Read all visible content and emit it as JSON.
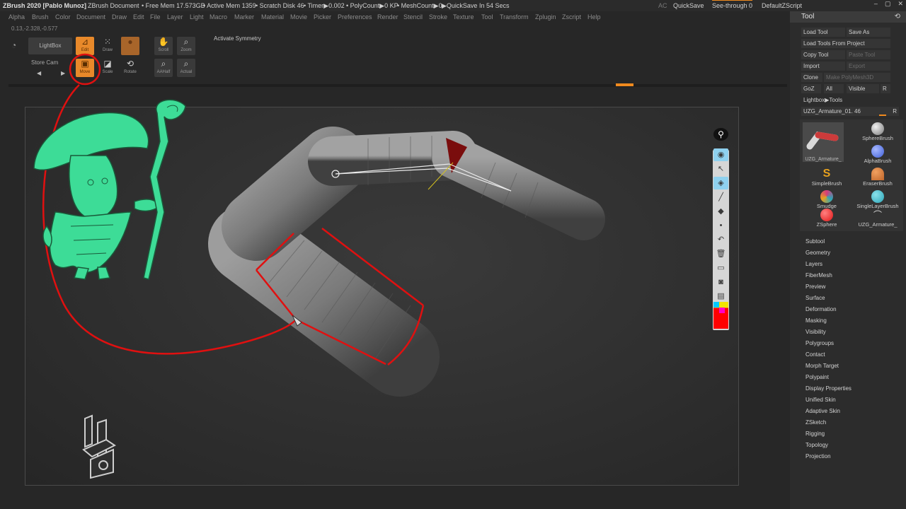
{
  "titlebar": {
    "app": "ZBrush 2020 [Pablo Munoz]",
    "document": "ZBrush Document",
    "free_mem": "• Free Mem 17.573GB",
    "active_mem": "• Active Mem 1359",
    "scratch": "• Scratch Disk 46",
    "timer": "• Timer▶0.002",
    "polycount": "• PolyCount▶0 KP",
    "meshcount": "• MeshCount▶0",
    "quicksave_in": "▶QuickSave In 54 Secs",
    "ac": "AC",
    "quicksave": "QuickSave",
    "see_through": "See-through  0",
    "default_script": "DefaultZScript"
  },
  "menu": [
    "Alpha",
    "Brush",
    "Color",
    "Document",
    "Draw",
    "Edit",
    "File",
    "Layer",
    "Light",
    "Macro",
    "Marker",
    "Material",
    "Movie",
    "Picker",
    "Preferences",
    "Render",
    "Stencil",
    "Stroke",
    "Texture",
    "Tool",
    "Transform",
    "Zplugin",
    "Zscript",
    "Help"
  ],
  "coords": "0.13,-2.328,-0.577",
  "shelf": {
    "lightbox": "LightBox",
    "store_cam": "Store Cam",
    "activate_symmetry": "Activate Symmetry",
    "edit": "Edit",
    "draw": "Draw",
    "move": "Move",
    "scale": "Scale",
    "rotate": "Rotate",
    "scroll": "Scroll",
    "zoom": "Zoom",
    "actual": "Actual",
    "aahalf": "AAHalf"
  },
  "tool_panel": {
    "title": "Tool",
    "load_tool": "Load Tool",
    "save_as": "Save As",
    "load_from_project": "Load Tools From Project",
    "copy_tool": "Copy Tool",
    "paste_tool": "Paste Tool",
    "import": "Import",
    "export": "Export",
    "clone": "Clone",
    "make_polymesh": "Make PolyMesh3D",
    "goz": "GoZ",
    "all": "All",
    "visible": "Visible",
    "r": "R",
    "lightbox_tools": "Lightbox▶Tools",
    "current_tool": "UZG_Armature_01. 46",
    "grid": [
      {
        "label": "SphereBrush",
        "color": "#bdbdbd"
      },
      {
        "label": "UZG_Armature_",
        "color": "#cc3b3b"
      },
      {
        "label": "AlphaBrush",
        "color": "#3f5fd8"
      },
      {
        "label": "SimpleBrush",
        "color": "#e8a21e"
      },
      {
        "label": "EraserBrush",
        "color": "#c0662a"
      },
      {
        "label": "Smudge",
        "color": "#d63b7a"
      },
      {
        "label": "SingleLayerBrush",
        "color": "#2ba6b8"
      },
      {
        "label": "ZSphere",
        "color": "#e01616"
      },
      {
        "label": "UZG_Armature_",
        "color": "#cc3b3b"
      }
    ],
    "subpalettes": [
      "Subtool",
      "Geometry",
      "Layers",
      "FiberMesh",
      "Preview",
      "Surface",
      "Deformation",
      "Masking",
      "Visibility",
      "Polygroups",
      "Contact",
      "Morph Target",
      "Polypaint",
      "Display Properties",
      "Unified Skin",
      "Adaptive Skin",
      "ZSketch",
      "Rigging",
      "Topology",
      "Projection"
    ]
  },
  "colors": {
    "accent": "#f08a1e",
    "annotation": "#e01010",
    "character": "#3ddc97"
  },
  "icons": [
    "pin-icon",
    "eye-icon",
    "cursor-icon",
    "eraser-icon",
    "brush-icon",
    "undo-icon",
    "trash-icon",
    "camera-icon",
    "clipboard-icon",
    "zbrush-logo-icon"
  ]
}
